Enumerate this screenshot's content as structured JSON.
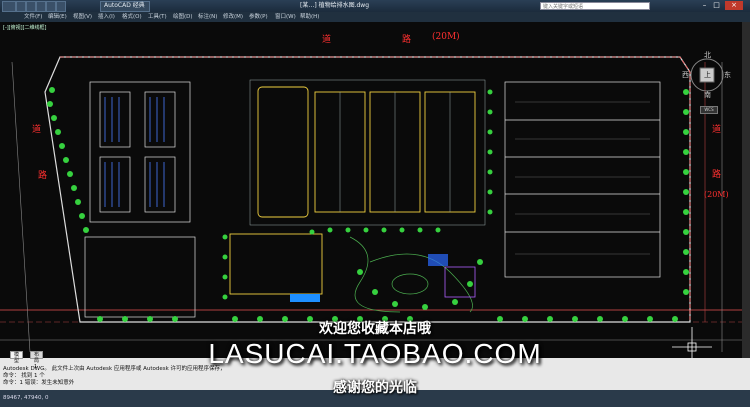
{
  "titlebar": {
    "app_tab": "AutoCAD 经典",
    "file_title": "[某…] 植物给排水图.dwg",
    "search_placeholder": "键入关键字或短语"
  },
  "menu": [
    "文件(F)",
    "编辑(E)",
    "视图(V)",
    "插入(I)",
    "格式(O)",
    "工具(T)",
    "绘图(D)",
    "标注(N)",
    "修改(M)",
    "参数(P)",
    "窗口(W)",
    "帮助(H)"
  ],
  "viewport": {
    "label": "[-][俯视][二维线框]",
    "road_top_1": "道",
    "road_top_2": "路",
    "road_top_3": "(20M)",
    "road_left_1": "道",
    "road_left_2": "路",
    "road_right_1": "道",
    "road_right_2": "路",
    "road_right_3": "(20M)"
  },
  "compass": {
    "north": "北",
    "south": "南",
    "east": "东",
    "west": "西",
    "center": "上",
    "wcs": "WCS"
  },
  "layout_tabs": [
    "模型",
    "布局1"
  ],
  "command": {
    "line1": "Autodesk DWG。 此文件上次由 Autodesk 应用程序或 Autodesk 许可的应用程序保存，",
    "line2": "命令： 找到 1 个",
    "line3": "命令：1 错误：发生未知意外"
  },
  "status": {
    "coords": "89467, 47940, 0"
  },
  "overlay": {
    "line1": "欢迎您收藏本店哦",
    "line2": "LASUCAI.TAOBAO.COM",
    "line3": "感谢您的光临"
  }
}
